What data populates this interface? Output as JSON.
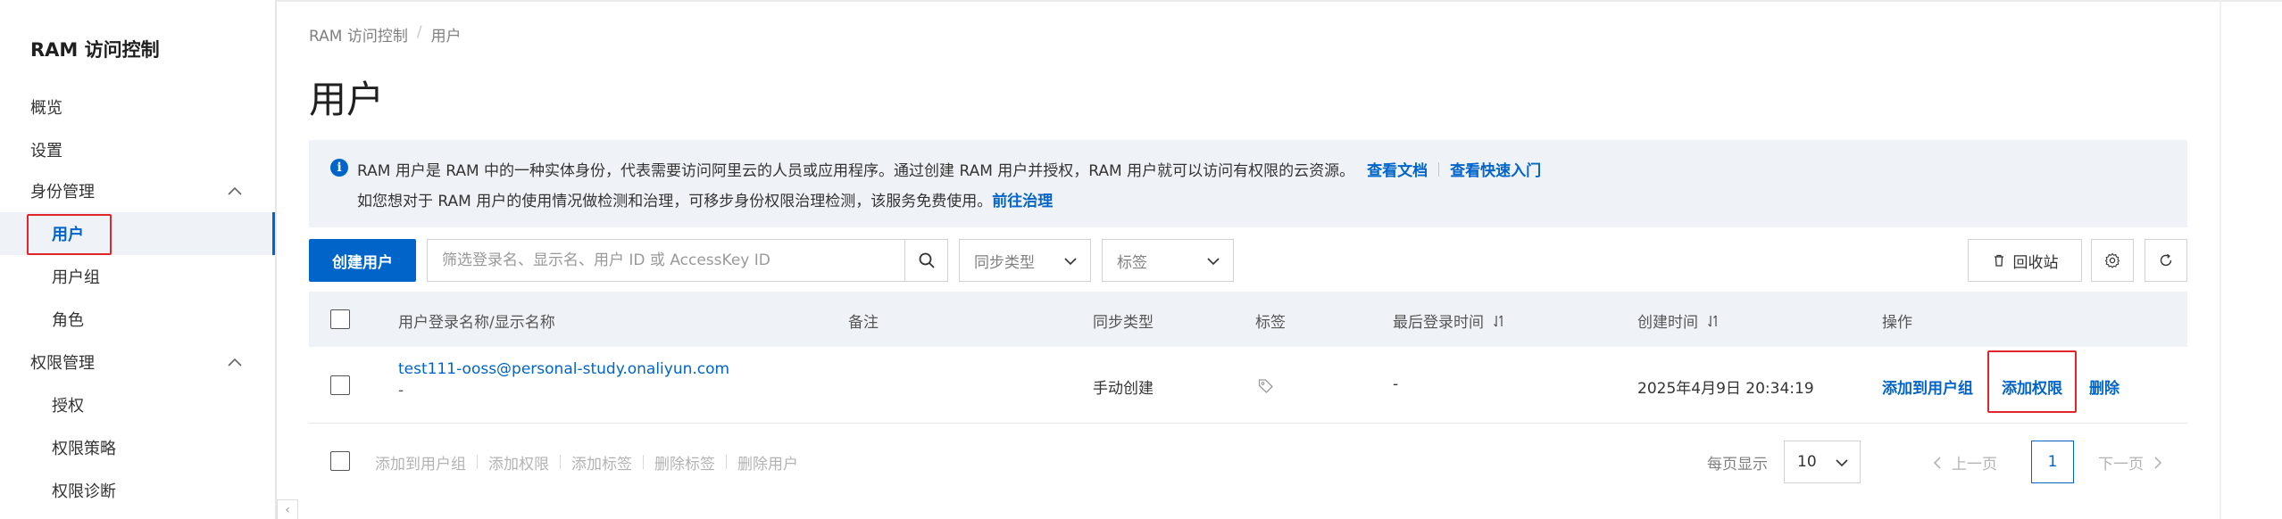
{
  "sidebar": {
    "title": "RAM 访问控制",
    "items": [
      {
        "label": "概览"
      },
      {
        "label": "设置"
      },
      {
        "label": "身份管理"
      },
      {
        "label": "用户"
      },
      {
        "label": "用户组"
      },
      {
        "label": "角色"
      },
      {
        "label": "权限管理"
      },
      {
        "label": "授权"
      },
      {
        "label": "权限策略"
      },
      {
        "label": "权限诊断"
      }
    ]
  },
  "breadcrumb": {
    "root": "RAM 访问控制",
    "sep": "/",
    "current": "用户"
  },
  "page_title": "用户",
  "info": {
    "line1_text": "RAM 用户是 RAM 中的一种实体身份，代表需要访问阿里云的人员或应用程序。通过创建 RAM 用户并授权，RAM 用户就可以访问有权限的云资源。",
    "link_docs": "查看文档",
    "link_quickstart": "查看快速入门",
    "line2_text": "如您想对于 RAM 用户的使用情况做检测和治理，可移步身份权限治理检测，该服务免费使用。",
    "link_govern": "前往治理"
  },
  "toolbar": {
    "create_label": "创建用户",
    "search_placeholder": "筛选登录名、显示名、用户 ID 或 AccessKey ID",
    "sync_type_label": "同步类型",
    "tag_label": "标签",
    "recycle_label": "回收站"
  },
  "table": {
    "headers": {
      "name": "用户登录名称/显示名称",
      "note": "备注",
      "sync": "同步类型",
      "tag": "标签",
      "last_login": "最后登录时间",
      "created": "创建时间",
      "ops": "操作"
    },
    "rows": [
      {
        "login_name": "test111-ooss@personal-study.onaliyun.com",
        "display_name": "-",
        "sync": "手动创建",
        "last_login": "-",
        "created": "2025年4月9日 20:34:19",
        "op_add_group": "添加到用户组",
        "op_add_perm": "添加权限",
        "op_delete": "删除"
      }
    ]
  },
  "batch": {
    "add_group": "添加到用户组",
    "add_perm": "添加权限",
    "add_tag": "添加标签",
    "delete_tag": "删除标签",
    "delete_user": "删除用户"
  },
  "pager": {
    "per_page_label": "每页显示",
    "page_size": "10",
    "prev": "上一页",
    "current_page": "1",
    "next": "下一页"
  },
  "colors": {
    "primary": "#0064c8",
    "highlight": "#e0262b",
    "accent": "#ff6a00"
  }
}
